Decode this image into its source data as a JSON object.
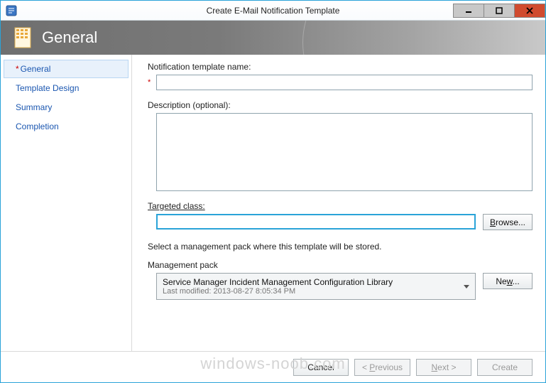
{
  "window": {
    "title": "Create E-Mail Notification Template"
  },
  "banner": {
    "title": "General"
  },
  "nav": {
    "items": [
      {
        "label": "General",
        "required": true,
        "active": true
      },
      {
        "label": "Template Design",
        "required": false,
        "active": false
      },
      {
        "label": "Summary",
        "required": false,
        "active": false
      },
      {
        "label": "Completion",
        "required": false,
        "active": false
      }
    ]
  },
  "form": {
    "name_label": "Notification template name:",
    "name_value": "",
    "description_label": "Description (optional):",
    "description_value": "",
    "targeted_class_label": "Targeted class:",
    "targeted_class_value": "",
    "browse_label": "Browse...",
    "mp_helper": "Select a management pack where this template will be stored.",
    "mp_label": "Management pack",
    "mp_selected": "Service Manager Incident Management Configuration Library",
    "mp_modified_label": "Last modified:",
    "mp_modified_value": "2013-08-27 8:05:34 PM",
    "new_label": "New..."
  },
  "footer": {
    "cancel": "Cancel",
    "previous": "< Previous",
    "next": "Next >",
    "create": "Create"
  },
  "watermark": "windows-noob.com"
}
